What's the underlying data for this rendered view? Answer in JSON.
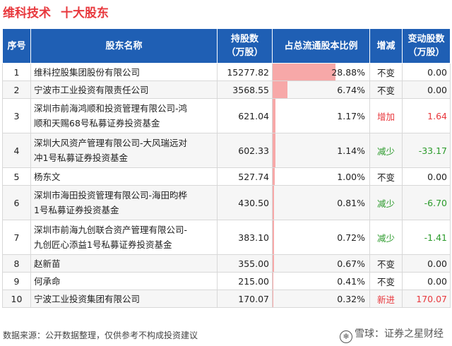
{
  "title": {
    "company": "维科技术",
    "subtitle": "十大股东"
  },
  "headers": {
    "idx": "序号",
    "name": "股东名称",
    "shares_line1": "持股数",
    "shares_line2": "（万股）",
    "ratio": "占总流通股本比例",
    "change": "增减",
    "delta_line1": "变动股数",
    "delta_line2": "（万股）"
  },
  "rows": [
    {
      "idx": "1",
      "name": "维科控股集团股份有限公司",
      "shares": "15277.82",
      "ratio": "28.88%",
      "ratio_value": 28.88,
      "change": "不变",
      "delta": "0.00"
    },
    {
      "idx": "2",
      "name": "宁波市工业投资有限责任公司",
      "shares": "3568.55",
      "ratio": "6.74%",
      "ratio_value": 6.74,
      "change": "不变",
      "delta": "0.00"
    },
    {
      "idx": "3",
      "name_l1": "深圳市前海鸿顺和投资管理有限公司-鸿",
      "name_l2": "顺和天赐68号私募证券投资基金",
      "shares": "621.04",
      "ratio": "1.17%",
      "ratio_value": 1.17,
      "change": "增加",
      "delta": "1.64"
    },
    {
      "idx": "4",
      "name_l1": "深圳大风资产管理有限公司-大风瑞远对",
      "name_l2": "冲1号私募证券投资基金",
      "shares": "602.33",
      "ratio": "1.14%",
      "ratio_value": 1.14,
      "change": "减少",
      "delta": "-33.17"
    },
    {
      "idx": "5",
      "name": "杨东文",
      "shares": "527.74",
      "ratio": "1.00%",
      "ratio_value": 1.0,
      "change": "不变",
      "delta": "0.00"
    },
    {
      "idx": "6",
      "name_l1": "深圳市海田投资管理有限公司-海田昀桦",
      "name_l2": "1号私募证券投资基金",
      "shares": "430.50",
      "ratio": "0.81%",
      "ratio_value": 0.81,
      "change": "减少",
      "delta": "-6.70"
    },
    {
      "idx": "7",
      "name_l1": "深圳市前海九创联合资产管理有限公司-",
      "name_l2": "九创匠心添益1号私募证券投资基金",
      "shares": "383.10",
      "ratio": "0.72%",
      "ratio_value": 0.72,
      "change": "减少",
      "delta": "-1.41"
    },
    {
      "idx": "8",
      "name": "赵新苗",
      "shares": "355.00",
      "ratio": "0.67%",
      "ratio_value": 0.67,
      "change": "不变",
      "delta": "0.00"
    },
    {
      "idx": "9",
      "name": "何承命",
      "shares": "215.00",
      "ratio": "0.41%",
      "ratio_value": 0.41,
      "change": "不变",
      "delta": "0.00"
    },
    {
      "idx": "10",
      "name": "宁波工业投资集团有限公司",
      "shares": "170.07",
      "ratio": "0.32%",
      "ratio_value": 0.32,
      "change": "新进",
      "delta": "170.07"
    }
  ],
  "colors": {
    "title": "#e8383d",
    "header_bg": "#1f5fb4",
    "bar": "#f7a8a8",
    "increase": "#e8383d",
    "decrease": "#2a9a2a"
  },
  "footer": {
    "source": "数据来源：公开数据整理，仅供参考不构成投资建议"
  },
  "brand": {
    "icon": "snowball-icon",
    "text": "雪球：证券之星财经"
  }
}
